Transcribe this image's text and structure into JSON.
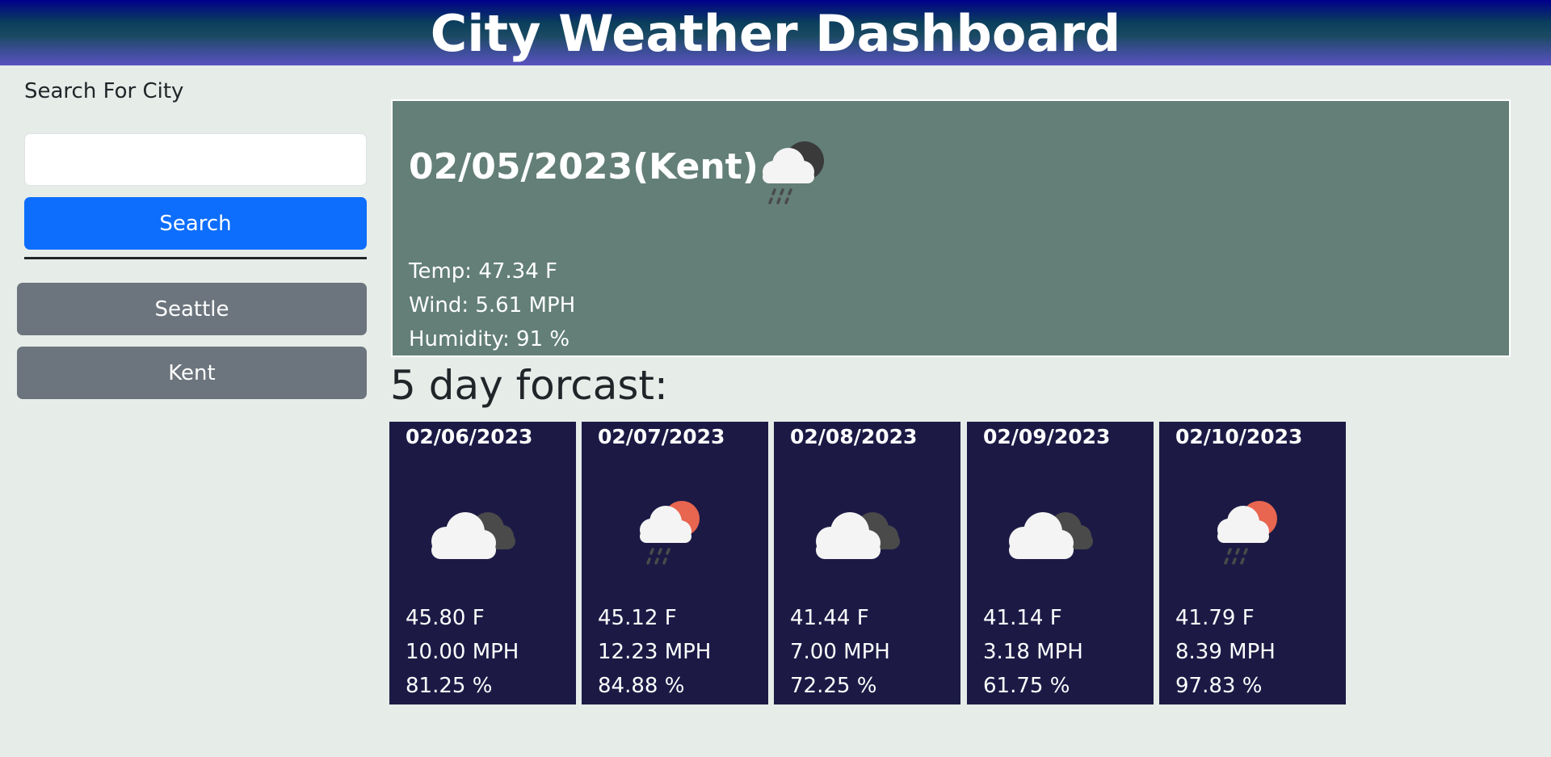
{
  "header": {
    "title": "City Weather Dashboard"
  },
  "sidebar": {
    "search_label": "Search For City",
    "search_value": "",
    "search_placeholder": "",
    "search_button": "Search",
    "history": [
      "Seattle",
      "Kent"
    ]
  },
  "current": {
    "title": "02/05/2023(Kent)",
    "icon": "cloud-rain-night-icon",
    "temp": "Temp: 47.34 F",
    "wind": "Wind: 5.61 MPH",
    "humidity": "Humidity: 91 %"
  },
  "forecast": {
    "heading": "5 day forcast:",
    "days": [
      {
        "date": "02/06/2023",
        "icon": "overcast-clouds-icon",
        "temp": "45.80 F",
        "wind": "10.00 MPH",
        "humidity": "81.25 %"
      },
      {
        "date": "02/07/2023",
        "icon": "cloud-rain-sun-icon",
        "temp": "45.12 F",
        "wind": "12.23 MPH",
        "humidity": "84.88 %"
      },
      {
        "date": "02/08/2023",
        "icon": "overcast-clouds-icon",
        "temp": "41.44 F",
        "wind": "7.00 MPH",
        "humidity": "72.25 %"
      },
      {
        "date": "02/09/2023",
        "icon": "overcast-clouds-icon",
        "temp": "41.14 F",
        "wind": "3.18 MPH",
        "humidity": "61.75 %"
      },
      {
        "date": "02/10/2023",
        "icon": "cloud-rain-sun-icon",
        "temp": "41.79 F",
        "wind": "8.39 MPH",
        "humidity": "97.83 %"
      }
    ]
  },
  "colors": {
    "current_card": "#637f77",
    "forecast_card": "#1c1a45",
    "search_button": "#0d6efd",
    "history_button": "#6c757d",
    "sun": "#e8654f"
  }
}
